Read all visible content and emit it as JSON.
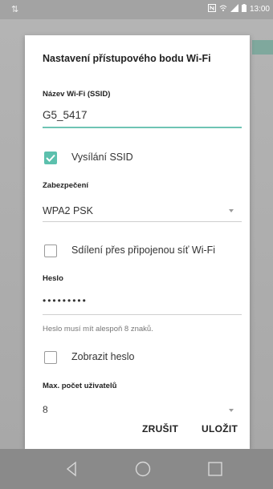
{
  "statusbar": {
    "time": "13:00"
  },
  "dialog": {
    "title": "Nastavení přístupového bodu Wi-Fi",
    "ssid_label": "Název Wi-Fi (SSID)",
    "ssid_value": "G5_5417",
    "broadcast_ssid": {
      "label": "Vysílání SSID",
      "checked": true
    },
    "security_label": "Zabezpečení",
    "security_value": "WPA2 PSK",
    "share_connected": {
      "label": "Sdílení přes připojenou síť Wi-Fi",
      "checked": false
    },
    "password_label": "Heslo",
    "password_value": "•••••••••",
    "password_hint": "Heslo musí mít alespoň 8 znaků.",
    "show_password": {
      "label": "Zobrazit heslo",
      "checked": false
    },
    "max_users_label": "Max. počet uživatelů",
    "max_users_value": "8",
    "cancel_label": "ZRUŠIT",
    "save_label": "ULOŽIT"
  },
  "colors": {
    "accent": "#5cc0ad",
    "underline_active": "#6fc4b4"
  },
  "icons": {
    "status": [
      "nfc-icon",
      "wifi-icon",
      "signal-icon",
      "battery-icon"
    ],
    "nav": [
      "back-icon",
      "home-icon",
      "recents-icon"
    ]
  }
}
